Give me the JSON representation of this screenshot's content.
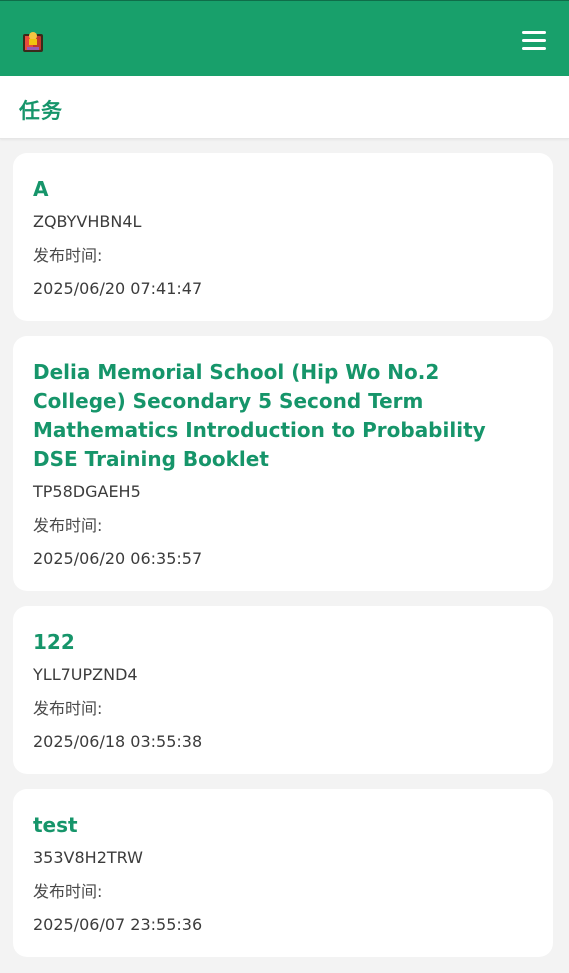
{
  "app": {
    "logo_icon": "app-logo-icon",
    "menu_icon": "hamburger-menu-icon",
    "brand_color": "#18a06b",
    "accent_text_color": "#16956a"
  },
  "page": {
    "title": "任务"
  },
  "tasks": [
    {
      "title": "A",
      "code": "ZQBYVHBN4L",
      "time_label": "发布时间:",
      "time": "2025/06/20 07:41:47"
    },
    {
      "title": "Delia Memorial School (Hip Wo No.2 College) Secondary 5 Second Term Mathematics Introduction to Probability DSE Training Booklet",
      "code": "TP58DGAEH5",
      "time_label": "发布时间:",
      "time": "2025/06/20 06:35:57"
    },
    {
      "title": "122",
      "code": "YLL7UPZND4",
      "time_label": "发布时间:",
      "time": "2025/06/18 03:55:38"
    },
    {
      "title": "test",
      "code": "353V8H2TRW",
      "time_label": "发布时间:",
      "time": "2025/06/07 23:55:36"
    }
  ]
}
